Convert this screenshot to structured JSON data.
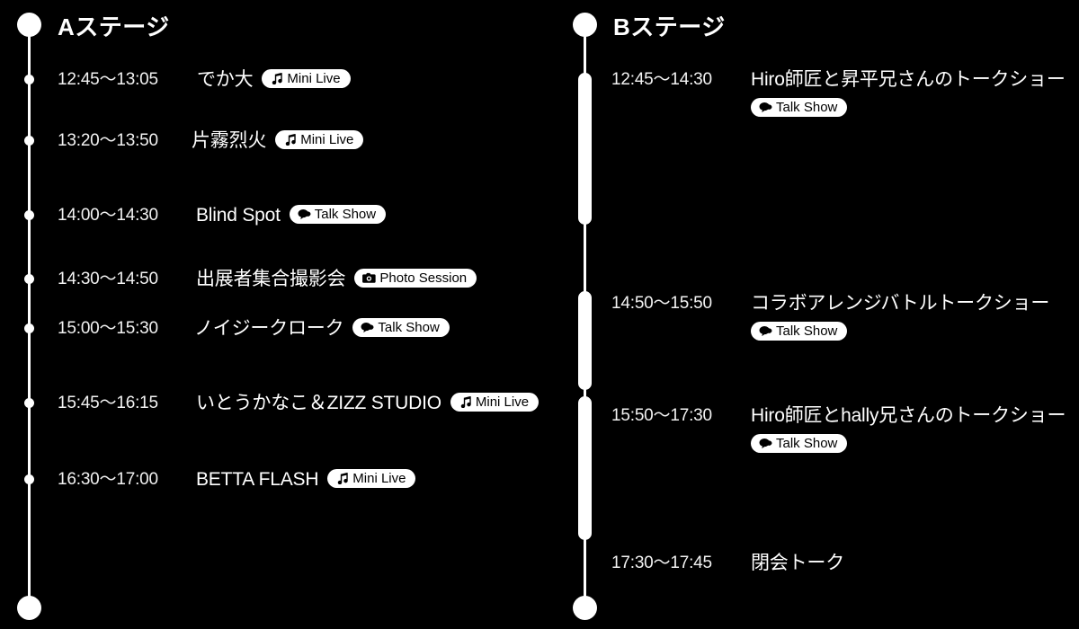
{
  "theme": {
    "background": "#000000",
    "foreground": "#ffffff",
    "badge_bg": "#ffffff",
    "badge_fg": "#000000"
  },
  "stages": [
    {
      "id": "a",
      "title": "Aステージ",
      "rail_style": "dots",
      "events": [
        {
          "time": "12:45〜13:05",
          "title": "でか大",
          "badge": {
            "label": "Mini Live",
            "icon": "music-note-icon"
          }
        },
        {
          "time": "13:20〜13:50",
          "title": "片霧烈火",
          "badge": {
            "label": "Mini Live",
            "icon": "music-note-icon"
          }
        },
        {
          "time": "14:00〜14:30",
          "title": "Blind Spot",
          "badge": {
            "label": "Talk Show",
            "icon": "speech-bubble-icon"
          }
        },
        {
          "time": "14:30〜14:50",
          "title": "出展者集合撮影会",
          "badge": {
            "label": "Photo Session",
            "icon": "camera-icon"
          }
        },
        {
          "time": "15:00〜15:30",
          "title": "ノイジークローク",
          "badge": {
            "label": "Talk Show",
            "icon": "speech-bubble-icon"
          }
        },
        {
          "time": "15:45〜16:15",
          "title": "いとうかなこ＆ZIZZ STUDIO",
          "badge": {
            "label": "Mini Live",
            "icon": "music-note-icon"
          }
        },
        {
          "time": "16:30〜17:00",
          "title": "BETTA FLASH",
          "badge": {
            "label": "Mini Live",
            "icon": "music-note-icon"
          }
        }
      ]
    },
    {
      "id": "b",
      "title": "Bステージ",
      "rail_style": "duration-bars",
      "events": [
        {
          "time": "12:45〜14:30",
          "title": "Hiro師匠と昇平兄さんのトークショー",
          "badge": {
            "label": "Talk Show",
            "icon": "speech-bubble-icon"
          }
        },
        {
          "time": "14:50〜15:50",
          "title": "コラボアレンジバトルトークショー",
          "badge": {
            "label": "Talk Show",
            "icon": "speech-bubble-icon"
          }
        },
        {
          "time": "15:50〜17:30",
          "title": "Hiro師匠とhally兄さんのトークショー",
          "badge": {
            "label": "Talk Show",
            "icon": "speech-bubble-icon"
          }
        },
        {
          "time": "17:30〜17:45",
          "title": "閉会トーク",
          "badge": null
        }
      ]
    }
  ]
}
